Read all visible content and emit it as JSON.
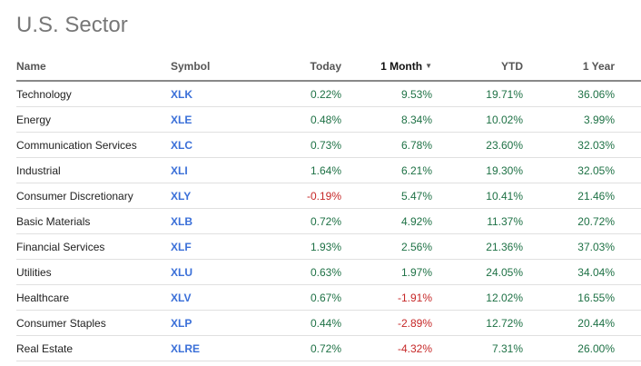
{
  "title": "U.S. Sector",
  "columns": {
    "name": "Name",
    "symbol": "Symbol",
    "today": "Today",
    "month": "1 Month",
    "ytd": "YTD",
    "year": "1 Year"
  },
  "sort": {
    "column": "1 Month",
    "direction": "descending",
    "icon": "caret-down-icon"
  },
  "colors": {
    "positive": "#1e7145",
    "negative": "#c62828",
    "symbol": "#3a6fd8"
  },
  "rows": [
    {
      "name": "Technology",
      "symbol": "XLK",
      "today": "0.22%",
      "month": "9.53%",
      "ytd": "19.71%",
      "year": "36.06%"
    },
    {
      "name": "Energy",
      "symbol": "XLE",
      "today": "0.48%",
      "month": "8.34%",
      "ytd": "10.02%",
      "year": "3.99%"
    },
    {
      "name": "Communication Services",
      "symbol": "XLC",
      "today": "0.73%",
      "month": "6.78%",
      "ytd": "23.60%",
      "year": "32.03%"
    },
    {
      "name": "Industrial",
      "symbol": "XLI",
      "today": "1.64%",
      "month": "6.21%",
      "ytd": "19.30%",
      "year": "32.05%"
    },
    {
      "name": "Consumer Discretionary",
      "symbol": "XLY",
      "today": "-0.19%",
      "month": "5.47%",
      "ytd": "10.41%",
      "year": "21.46%"
    },
    {
      "name": "Basic Materials",
      "symbol": "XLB",
      "today": "0.72%",
      "month": "4.92%",
      "ytd": "11.37%",
      "year": "20.72%"
    },
    {
      "name": "Financial Services",
      "symbol": "XLF",
      "today": "1.93%",
      "month": "2.56%",
      "ytd": "21.36%",
      "year": "37.03%"
    },
    {
      "name": "Utilities",
      "symbol": "XLU",
      "today": "0.63%",
      "month": "1.97%",
      "ytd": "24.05%",
      "year": "34.04%"
    },
    {
      "name": "Healthcare",
      "symbol": "XLV",
      "today": "0.67%",
      "month": "-1.91%",
      "ytd": "12.02%",
      "year": "16.55%"
    },
    {
      "name": "Consumer Staples",
      "symbol": "XLP",
      "today": "0.44%",
      "month": "-2.89%",
      "ytd": "12.72%",
      "year": "20.44%"
    },
    {
      "name": "Real Estate",
      "symbol": "XLRE",
      "today": "0.72%",
      "month": "-4.32%",
      "ytd": "7.31%",
      "year": "26.00%"
    }
  ]
}
